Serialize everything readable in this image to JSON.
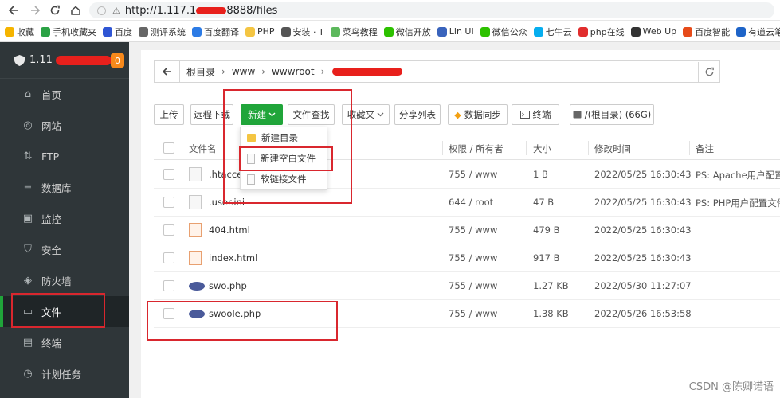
{
  "browser": {
    "url_prefix": "http://1.117.1",
    "url_suffix": "8888/files",
    "bookmarks": [
      {
        "label": "收藏",
        "icon": "star-icon",
        "color": "#f5b400"
      },
      {
        "label": "手机收藏夹",
        "icon": "mobile-icon",
        "color": "#2ba245"
      },
      {
        "label": "百度",
        "icon": "baidu-icon",
        "color": "#2f55d4"
      },
      {
        "label": "测评系统",
        "icon": "globe-icon",
        "color": "#666666"
      },
      {
        "label": "百度翻译",
        "icon": "translate-icon",
        "color": "#2c7be5"
      },
      {
        "label": "PHP",
        "icon": "folder-icon",
        "color": "#f4c542"
      },
      {
        "label": "安装 · T",
        "icon": "gear-icon",
        "color": "#555555"
      },
      {
        "label": "菜鸟教程",
        "icon": "runoob-icon",
        "color": "#5cb85c"
      },
      {
        "label": "微信开放",
        "icon": "wechat-icon",
        "color": "#2dc100"
      },
      {
        "label": "Lin UI",
        "icon": "linui-icon",
        "color": "#3963bc"
      },
      {
        "label": "微信公众",
        "icon": "wechat-icon",
        "color": "#2dc100"
      },
      {
        "label": "七牛云",
        "icon": "qiniu-icon",
        "color": "#06aeef"
      },
      {
        "label": "php在线",
        "icon": "php-icon",
        "color": "#e12d2d"
      },
      {
        "label": "Web Up",
        "icon": "web-icon",
        "color": "#333333"
      },
      {
        "label": "百度智能",
        "icon": "baidu-ai-icon",
        "color": "#e64a19"
      },
      {
        "label": "有道云笔",
        "icon": "youdao-icon",
        "color": "#1e64c8"
      }
    ]
  },
  "sidebar": {
    "badge": "0",
    "items": [
      {
        "label": "首页",
        "icon": "home-icon"
      },
      {
        "label": "网站",
        "icon": "globe-icon"
      },
      {
        "label": "FTP",
        "icon": "ftp-icon"
      },
      {
        "label": "数据库",
        "icon": "database-icon"
      },
      {
        "label": "监控",
        "icon": "monitor-icon"
      },
      {
        "label": "安全",
        "icon": "shield-icon"
      },
      {
        "label": "防火墙",
        "icon": "firewall-icon"
      },
      {
        "label": "文件",
        "icon": "folder-icon",
        "active": true
      },
      {
        "label": "终端",
        "icon": "terminal-icon"
      },
      {
        "label": "计划任务",
        "icon": "clock-icon"
      }
    ]
  },
  "breadcrumb": [
    "根目录",
    "www",
    "wwwroot"
  ],
  "toolbar": {
    "upload": "上传",
    "remote_download": "远程下载",
    "new": "新建",
    "file_search": "文件查找",
    "favorites": "收藏夹",
    "share_list": "分享列表",
    "data_sync": "数据同步",
    "terminal": "终端",
    "disk": "/(根目录) (66G)"
  },
  "new_menu": [
    "新建目录",
    "新建空白文件",
    "软链接文件"
  ],
  "table": {
    "headers": {
      "name": "文件名",
      "perm": "权限 / 所有者",
      "size": "大小",
      "mtime": "修改时间",
      "note": "备注"
    },
    "rows": [
      {
        "name": ".htaccess",
        "type": "file",
        "perm": "755 / www",
        "size": "1 B",
        "mtime": "2022/05/25 16:30:43",
        "note": "PS: Apache用户配置文"
      },
      {
        "name": ".user.ini",
        "type": "file",
        "perm": "644 / root",
        "size": "47 B",
        "mtime": "2022/05/25 16:30:43",
        "note": "PS: PHP用户配置文件("
      },
      {
        "name": "404.html",
        "type": "html",
        "perm": "755 / www",
        "size": "479 B",
        "mtime": "2022/05/25 16:30:43",
        "note": ""
      },
      {
        "name": "index.html",
        "type": "html",
        "perm": "755 / www",
        "size": "917 B",
        "mtime": "2022/05/25 16:30:43",
        "note": ""
      },
      {
        "name": "swo.php",
        "type": "php",
        "perm": "755 / www",
        "size": "1.27 KB",
        "mtime": "2022/05/30 11:27:07",
        "note": ""
      },
      {
        "name": "swoole.php",
        "type": "php",
        "perm": "755 / www",
        "size": "1.38 KB",
        "mtime": "2022/05/26 16:53:58",
        "note": ""
      }
    ]
  },
  "watermark": "CSDN @陈卿诺语",
  "colors": {
    "accent": "#20a53a",
    "sidebar_bg": "#2f3639",
    "annotation": "#d9272e",
    "badge": "#f7891b"
  }
}
